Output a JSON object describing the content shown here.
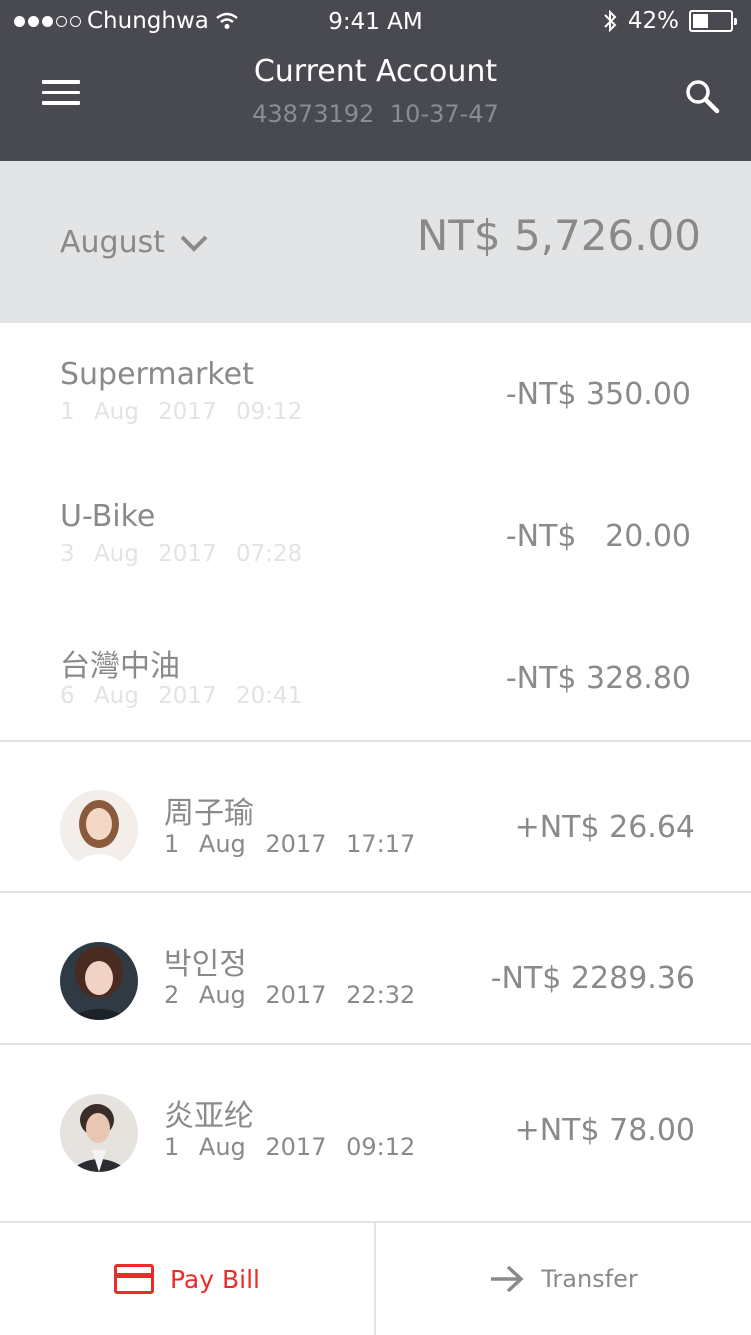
{
  "status_bar": {
    "carrier": "Chunghwa",
    "time": "9:41 AM",
    "battery_percent": "42%",
    "battery_level": 0.42,
    "signal_filled": 3,
    "signal_total": 5
  },
  "header": {
    "title": "Current Account",
    "account_number": "43873192  10-37-47",
    "menu_icon": "hamburger-icon",
    "search_icon": "search-icon"
  },
  "summary": {
    "month": "August",
    "balance": "NT$ 5,726.00"
  },
  "transactions": [
    {
      "name": "Supermarket",
      "date": "1 Aug 2017   09:12",
      "amount": "-NT$ 350.00"
    },
    {
      "name": "U-Bike",
      "date": "3 Aug 2017   07:28",
      "amount": "-NT$   20.00"
    },
    {
      "name": "台灣中油",
      "date": "6 Aug 2017   20:41",
      "amount": "-NT$ 328.80"
    }
  ],
  "contacts": [
    {
      "name": "周子瑜",
      "date": "1 Aug 2017   17:17",
      "amount": "+NT$ 26.64"
    },
    {
      "name": "박인정",
      "date": "2 Aug 2017   22:32",
      "amount": "-NT$ 2289.36"
    },
    {
      "name": "炎亚纶",
      "date": "1 Aug 2017   09:12",
      "amount": "+NT$ 78.00"
    }
  ],
  "actions": {
    "pay_bill": "Pay Bill",
    "transfer": "Transfer"
  },
  "colors": {
    "header_bg": "#494951",
    "month_bar_bg": "#e2e4e5",
    "accent_red": "#ee2a2a",
    "text_gray": "#8a8a8a"
  }
}
